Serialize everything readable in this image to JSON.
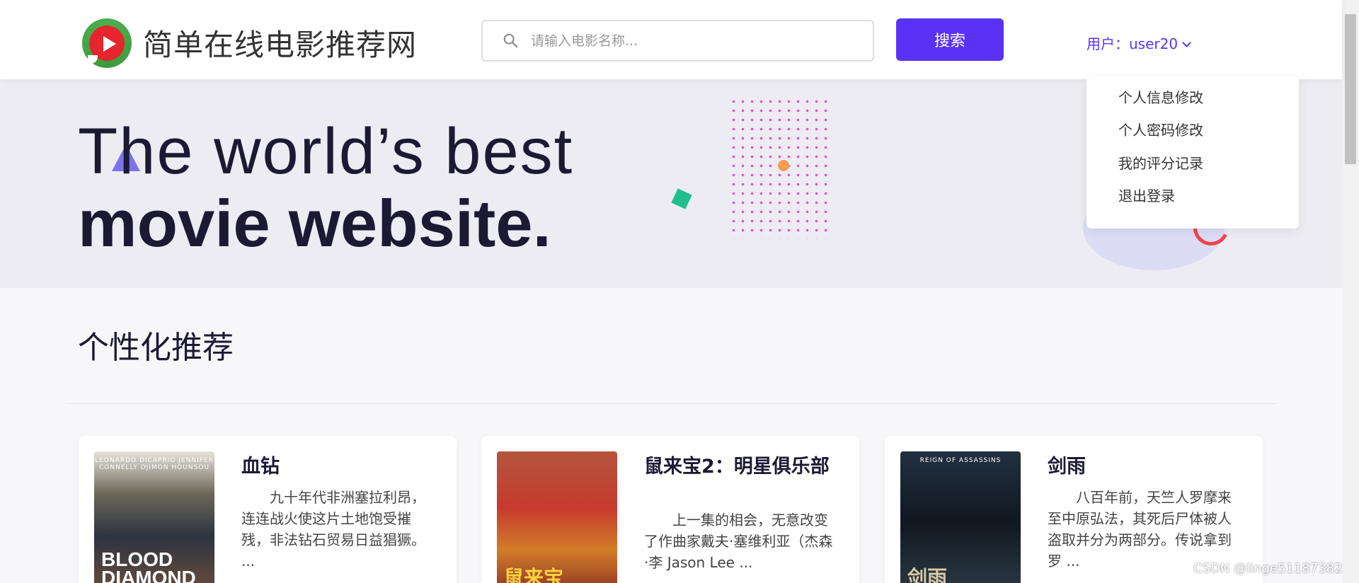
{
  "header": {
    "site_title": "简单在线电影推荐网",
    "search_placeholder": "请输入电影名称...",
    "search_button": "搜索",
    "user_label": "用户：user20"
  },
  "hero": {
    "line1": "The world’s best",
    "line2": "movie website."
  },
  "user_dropdown": {
    "items": [
      "个人信息修改",
      "个人密码修改",
      "我的评分记录",
      "退出登录"
    ]
  },
  "section": {
    "title": "个性化推荐"
  },
  "movies": [
    {
      "title": "血钻",
      "description": "九十年代非洲塞拉利昂，连连战火使这片土地饱受摧残，非法钻石贸易日益猖獗。　 ...",
      "poster_text": "BLOOD DIAMOND",
      "poster_caption": "LEONARDO DICAPRIO   JENNIFER CONNELLY   DJIMON HOUNSOU"
    },
    {
      "title": "鼠来宝2：明星俱乐部",
      "description": "上一集的相会，无意改变了作曲家戴夫·塞维利亚（杰森·李 Jason Lee ...",
      "poster_text": "鼠来宝",
      "poster_caption": ""
    },
    {
      "title": "剑雨",
      "description": "八百年前，天竺人罗摩来至中原弘法，其死后尸体被人盗取并分为两部分。传说拿到罗 ...",
      "poster_text": "剑雨",
      "poster_caption": "REIGN OF ASSASSINS"
    }
  ],
  "watermark": "CSDN @linge511873822",
  "colors": {
    "accent": "#5a32f5",
    "hero_bg": "#ececf2",
    "page_bg": "#f7f7fa"
  }
}
